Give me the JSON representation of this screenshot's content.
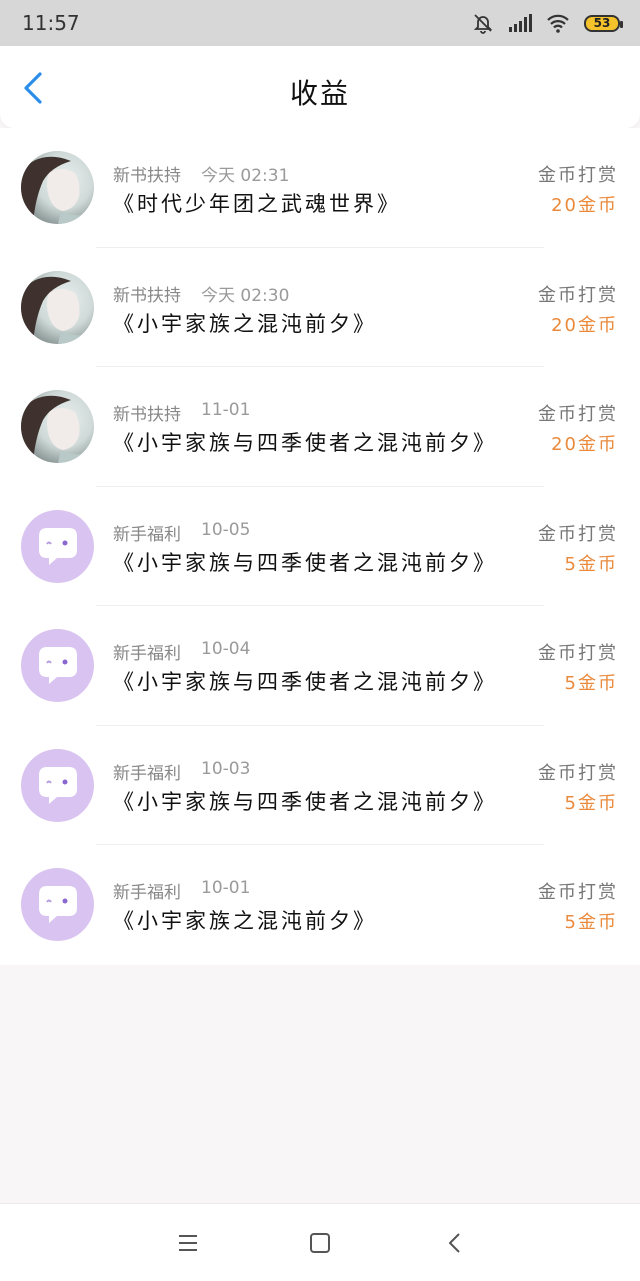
{
  "status_bar": {
    "time": "11:57",
    "battery": "53"
  },
  "header": {
    "title": "收益"
  },
  "items": [
    {
      "avatar": "avatar-illustration-icon",
      "source": "新书扶持",
      "time": "今天 02:31",
      "book": "《时代少年团之武魂世界》",
      "reward_type": "金币打赏",
      "reward_amount": "20金币"
    },
    {
      "avatar": "avatar-illustration-icon",
      "source": "新书扶持",
      "time": "今天 02:30",
      "book": "《小宇家族之混沌前夕》",
      "reward_type": "金币打赏",
      "reward_amount": "20金币"
    },
    {
      "avatar": "avatar-illustration-icon",
      "source": "新书扶持",
      "time": "11-01",
      "book": "《小宇家族与四季使者之混沌前夕》",
      "reward_type": "金币打赏",
      "reward_amount": "20金币"
    },
    {
      "avatar": "chat-bubble-icon",
      "source": "新手福利",
      "time": "10-05",
      "book": "《小宇家族与四季使者之混沌前夕》",
      "reward_type": "金币打赏",
      "reward_amount": "5金币"
    },
    {
      "avatar": "chat-bubble-icon",
      "source": "新手福利",
      "time": "10-04",
      "book": "《小宇家族与四季使者之混沌前夕》",
      "reward_type": "金币打赏",
      "reward_amount": "5金币"
    },
    {
      "avatar": "chat-bubble-icon",
      "source": "新手福利",
      "time": "10-03",
      "book": "《小宇家族与四季使者之混沌前夕》",
      "reward_type": "金币打赏",
      "reward_amount": "5金币"
    },
    {
      "avatar": "chat-bubble-icon",
      "source": "新手福利",
      "time": "10-01",
      "book": "《小宇家族之混沌前夕》",
      "reward_type": "金币打赏",
      "reward_amount": "5金币"
    }
  ],
  "colors": {
    "accent_blue": "#2a8ee8",
    "reward_orange": "#e98a3c",
    "bubble_purple": "#d9c3f0"
  }
}
